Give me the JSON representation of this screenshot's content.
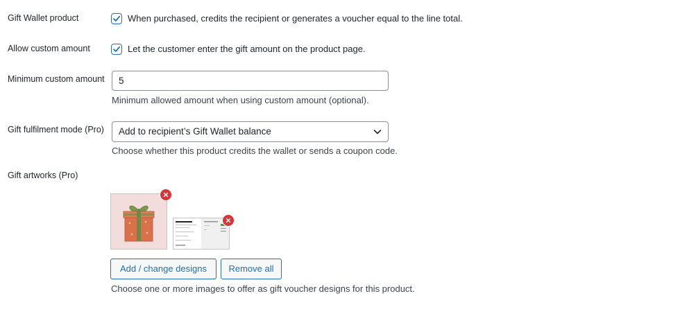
{
  "gift_wallet_product": {
    "label": "Gift Wallet product",
    "checked": true,
    "description": "When purchased, credits the recipient or generates a voucher equal to the line total."
  },
  "allow_custom_amount": {
    "label": "Allow custom amount",
    "checked": true,
    "description": "Let the customer enter the gift amount on the product page."
  },
  "minimum_custom_amount": {
    "label": "Minimum custom amount",
    "value": "5",
    "description": "Minimum allowed amount when using custom amount (optional)."
  },
  "fulfilment_mode": {
    "label": "Gift fulfilment mode (Pro)",
    "selected": "Add to recipient’s Gift Wallet balance",
    "description": "Choose whether this product credits the wallet or sends a coupon code."
  },
  "gift_artworks": {
    "label": "Gift artworks (Pro)",
    "images": [
      {
        "kind": "gift-box-artwork"
      },
      {
        "kind": "screenshot-artwork"
      }
    ],
    "add_button": "Add / change designs",
    "remove_button": "Remove all",
    "description": "Choose one or more images to offer as gift voucher designs for this product."
  },
  "colors": {
    "accent": "#2271b1",
    "danger": "#d63638",
    "text": "#1d2327",
    "muted": "#3c434a"
  }
}
